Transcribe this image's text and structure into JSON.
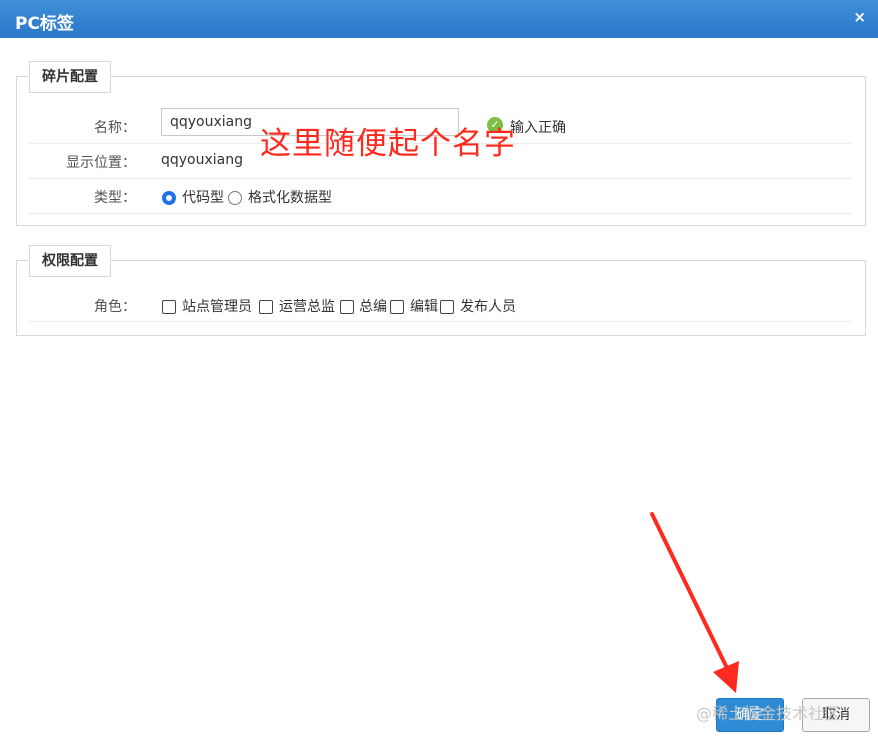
{
  "dialog": {
    "title": "PC标签",
    "close_glyph": "×"
  },
  "fragment_section": {
    "legend": "碎片配置",
    "name_label": "名称：",
    "name_value": "qqyouxiang",
    "validation_text": "输入正确",
    "display_label": "显示位置：",
    "display_value": "qqyouxiang",
    "type_label": "类型：",
    "type_options": [
      "代码型",
      "格式化数据型"
    ],
    "type_selected": "代码型"
  },
  "permission_section": {
    "legend": "权限配置",
    "role_label": "角色：",
    "roles": [
      "站点管理员",
      "运营总监",
      "总编",
      "编辑",
      "发布人员"
    ]
  },
  "annotation": {
    "text": "这里随便起个名字",
    "color": "#ff2a1f"
  },
  "buttons": {
    "confirm": "确定",
    "cancel": "取消"
  },
  "watermark": "@稀土掘金技术社区",
  "colors": {
    "titlebar": "#2f80d0",
    "primary_button": "#2e8bd6",
    "valid_icon": "#7bc043"
  }
}
